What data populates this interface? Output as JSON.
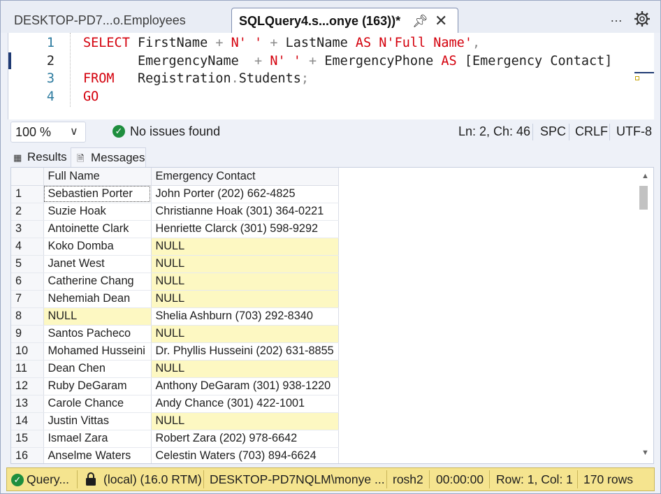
{
  "tabs": {
    "inactive_label": "DESKTOP-PD7...o.Employees",
    "active_label": "SQLQuery4.s...onye (163))*",
    "pin_icon": "pin-icon",
    "close_icon": "close-icon",
    "more_label": "…",
    "settings_icon": "gear-icon"
  },
  "editor": {
    "lines": [
      {
        "num": "1",
        "segments": [
          {
            "t": "SELECT ",
            "c": "kw"
          },
          {
            "t": "FirstName ",
            "c": "plain"
          },
          {
            "t": "+ ",
            "c": "op"
          },
          {
            "t": "N' '",
            "c": "str"
          },
          {
            "t": " + ",
            "c": "op"
          },
          {
            "t": "LastName ",
            "c": "plain"
          },
          {
            "t": "AS ",
            "c": "kw"
          },
          {
            "t": "N'Full Name'",
            "c": "str"
          },
          {
            "t": ",",
            "c": "op"
          }
        ]
      },
      {
        "num": "2",
        "segments": [
          {
            "t": "       EmergencyName  ",
            "c": "plain"
          },
          {
            "t": "+ ",
            "c": "op"
          },
          {
            "t": "N' '",
            "c": "str"
          },
          {
            "t": " + ",
            "c": "op"
          },
          {
            "t": "EmergencyPhone ",
            "c": "plain"
          },
          {
            "t": "AS ",
            "c": "kw"
          },
          {
            "t": "[Emergency Contact]",
            "c": "plain"
          }
        ]
      },
      {
        "num": "3",
        "segments": [
          {
            "t": "FROM   ",
            "c": "kw"
          },
          {
            "t": "Registration",
            "c": "plain"
          },
          {
            "t": ".",
            "c": "op"
          },
          {
            "t": "Students",
            "c": "plain"
          },
          {
            "t": ";",
            "c": "op"
          }
        ]
      },
      {
        "num": "4",
        "segments": [
          {
            "t": "GO",
            "c": "kw"
          }
        ]
      }
    ]
  },
  "editor_status": {
    "zoom": "100 %",
    "issues": "No issues found",
    "position": "Ln: 2, Ch: 46",
    "whitespace": "SPC",
    "line_ending": "CRLF",
    "encoding": "UTF-8"
  },
  "result_tabs": {
    "results": "Results",
    "messages": "Messages"
  },
  "grid": {
    "columns": [
      "Full Name",
      "Emergency Contact"
    ],
    "rows": [
      [
        "1",
        "Sebastien Porter",
        "John Porter (202) 662-4825"
      ],
      [
        "2",
        "Suzie Hoak",
        "Christianne Hoak (301) 364-0221"
      ],
      [
        "3",
        "Antoinette Clark",
        "Henriette Clarck (301) 598-9292"
      ],
      [
        "4",
        "Koko Domba",
        "NULL"
      ],
      [
        "5",
        "Janet West",
        "NULL"
      ],
      [
        "6",
        "Catherine Chang",
        "NULL"
      ],
      [
        "7",
        "Nehemiah Dean",
        "NULL"
      ],
      [
        "8",
        "NULL",
        "Shelia Ashburn (703) 292-8340"
      ],
      [
        "9",
        "Santos Pacheco",
        "NULL"
      ],
      [
        "10",
        "Mohamed Husseini",
        "Dr. Phyllis Husseini (202) 631-8855"
      ],
      [
        "11",
        "Dean Chen",
        "NULL"
      ],
      [
        "12",
        "Ruby DeGaram",
        "Anthony DeGaram (301) 938-1220"
      ],
      [
        "13",
        "Carole Chance",
        "Andy Chance (301) 422-1001"
      ],
      [
        "14",
        "Justin Vittas",
        "NULL"
      ],
      [
        "15",
        "Ismael Zara",
        "Robert Zara (202) 978-6642"
      ],
      [
        "16",
        "Anselme Waters",
        "Celestin Waters (703) 894-6624"
      ]
    ]
  },
  "status_bar": {
    "query": "Query...",
    "server": "(local) (16.0 RTM)",
    "user": "DESKTOP-PD7NQLM\\monye ...",
    "database": "rosh2",
    "elapsed": "00:00:00",
    "position": "Row: 1, Col: 1",
    "rows": "170 rows",
    "color": "#f5e48f"
  }
}
